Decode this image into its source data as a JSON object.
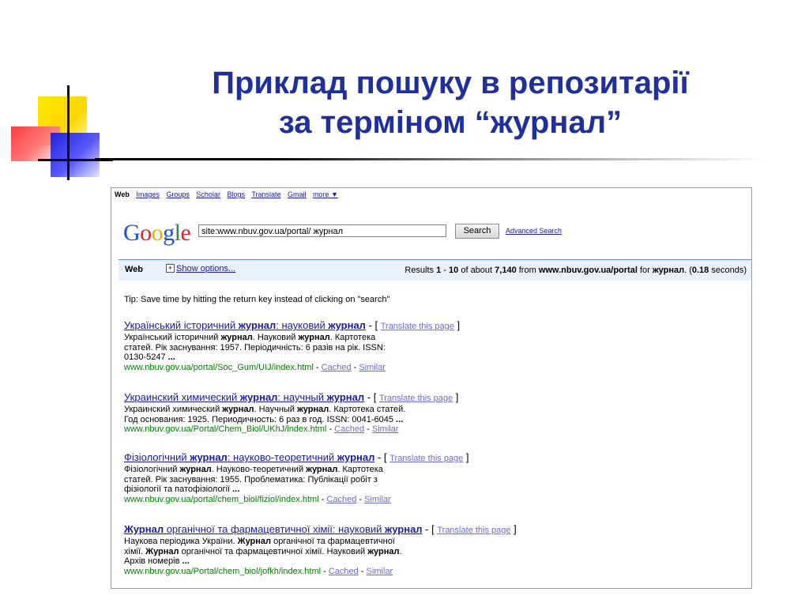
{
  "slide": {
    "title_line1": "Приклад пошуку в репозитарії",
    "title_line2": "за терміном “журнал”"
  },
  "google": {
    "nav": {
      "current": "Web",
      "links": [
        "Images",
        "Groups",
        "Scholar",
        "Blogs",
        "Translate",
        "Gmail",
        "more ▼"
      ]
    },
    "logo": {
      "letters": [
        "G",
        "o",
        "o",
        "g",
        "l",
        "e"
      ],
      "colors": [
        "#1c4fd8",
        "#d62828",
        "#e9b000",
        "#1c4fd8",
        "#1a9c2c",
        "#d62828"
      ]
    },
    "search": {
      "query": "site:www.nbuv.gov.ua/portal/ журнал",
      "button": "Search",
      "advanced": "Advanced Search"
    },
    "results_bar": {
      "web": "Web",
      "plus": "+",
      "show_options": "Show options...",
      "stats": {
        "prefix": "Results ",
        "from": "1",
        "dash": " - ",
        "to": "10",
        "of_about": " of about ",
        "total": "7,140",
        "from_label": " from ",
        "site": "www.nbuv.gov.ua/portal",
        "for_label": " for ",
        "term": "журнал",
        "paren_open": ". (",
        "time": "0.18",
        "seconds": " seconds)"
      }
    },
    "tip": "Tip: Save time by hitting the return key instead of clicking on \"search\"",
    "results": [
      {
        "title": "Український історичний журнал: науковий журнал",
        "translate": "Translate this page",
        "snippet": [
          "Український історичний журнал. Науковий журнал. Картотека",
          "статей. Рік заснування: 1957. Періодичність: 6 разів на рік. ISSN:",
          "0130-5247 ..."
        ],
        "url": "www.nbuv.gov.ua/portal/Soc_Gum/UIJ/index.html",
        "cached": "Cached",
        "similar": "Similar"
      },
      {
        "title": "Украинский химический журнал: научный журнал",
        "translate": "Translate this page",
        "snippet": [
          "Украинский химический журнал. Научный журнал. Картотека статей.",
          "Год основания: 1925. Периодичность: 6 раз в год. ISSN: 0041-6045 ..."
        ],
        "url": "www.nbuv.gov.ua/Portal/Chem_Biol/UKhJ/index.html",
        "cached": "Cached",
        "similar": "Similar"
      },
      {
        "title": "Фізіологічний журнал: науково-теоретичний журнал",
        "translate": "Translate this page",
        "snippet": [
          "Фізіологічний журнал. Науково-теоретичний журнал. Картотека",
          "статей. Рік заснування: 1955. Проблематика: Публікації робіт з",
          "фізіології та патофізіології ..."
        ],
        "url": "www.nbuv.gov.ua/portal/chem_biol/fiziol/index.html",
        "cached": "Cached",
        "similar": "Similar"
      },
      {
        "title": "Журнал органічної та фармацевтичної хімії: науковий журнал",
        "translate": "Translate this page",
        "snippet": [
          "Наукова періодика України. Журнал органічної та фармацевтичної",
          "хімії. Журнал органічної та фармацевтичної хімії. Науковий журнал.",
          "Архів номерів ..."
        ],
        "url": "www.nbuv.gov.ua/Portal/chem_biol/jofkh/index.html",
        "cached": "Cached",
        "similar": "Similar"
      }
    ],
    "separators": {
      "dash": " - ",
      "bracket_open": " - [ ",
      "bracket_close": " ]"
    }
  }
}
